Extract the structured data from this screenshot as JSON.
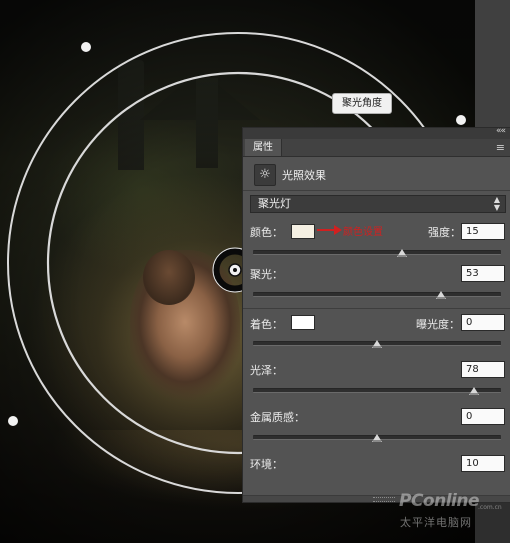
{
  "canvas": {
    "angle_label": "聚光角度"
  },
  "panel": {
    "collapse_glyph": "««",
    "tab_label": "属性",
    "menu_glyph": "≡",
    "effect_icon": "sun-icon",
    "effect_icon_glyph": "☼",
    "effect_title": "光照效果",
    "light_type": "聚光灯",
    "color_label": "颜色：",
    "color_swatch": "#f4efe2",
    "color_annotation": "颜色设置",
    "intensity_label": "强度：",
    "intensity_value": "15",
    "intensity_slider": 0.6,
    "hotspot_label": "聚光：",
    "hotspot_value": "53",
    "hotspot_slider": 0.76,
    "colorize_label": "着色：",
    "colorize_swatch": "#ffffff",
    "exposure_label": "曝光度：",
    "exposure_value": "0",
    "exposure_slider": 0.5,
    "gloss_label": "光泽：",
    "gloss_value": "78",
    "gloss_slider": 0.89,
    "metallic_label": "金属质感：",
    "metallic_value": "0",
    "metallic_slider": 0.5,
    "ambience_label": "环境：",
    "ambience_value": "10"
  },
  "watermark": {
    "brand": "PConline",
    "domain": ".com.cn",
    "tagline": "太平洋电脑网"
  },
  "colors": {
    "panel_bg": "#535353",
    "annotation_red": "#d02020"
  }
}
